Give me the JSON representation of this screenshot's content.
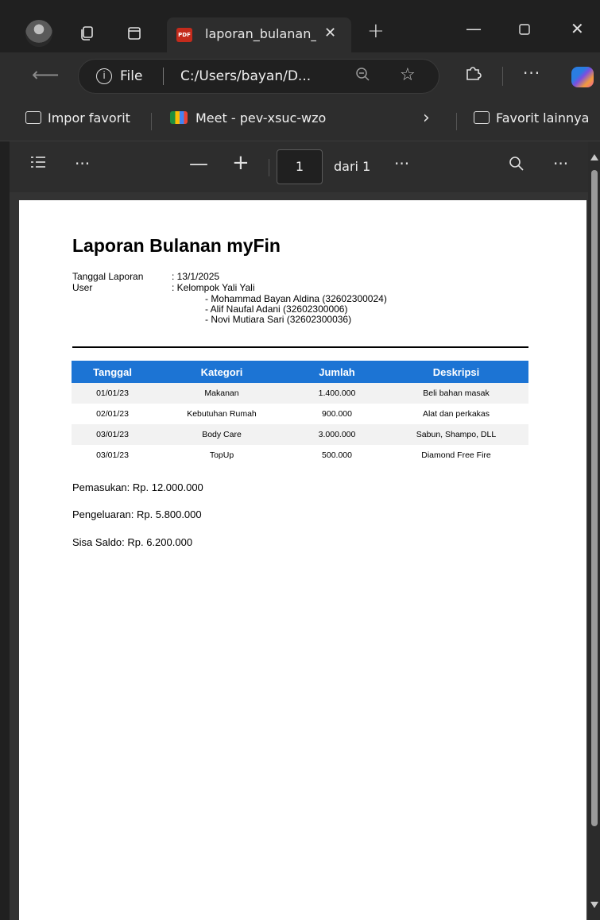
{
  "tab": {
    "title": "laporan_bulanan_",
    "pdf_badge": "PDF"
  },
  "address": {
    "scheme": "File",
    "url": "C:/Users/bayan/D..."
  },
  "favorites": {
    "import": "Impor favorit",
    "meet": "Meet - pev-xsuc-wzo",
    "others": "Favorit lainnya"
  },
  "pdf_toolbar": {
    "page": "1",
    "of": "dari 1"
  },
  "report": {
    "title": "Laporan Bulanan myFin",
    "date_label": "Tanggal Laporan",
    "date_value": ":  13/1/2025",
    "user_label": "User",
    "user_value": ":  Kelompok Yali Yali",
    "members": [
      "- Mohammad Bayan Aldina (32602300024)",
      "- Alif Naufal Adani (32602300006)",
      "- Novi Mutiara Sari (32602300036)"
    ],
    "columns": [
      "Tanggal",
      "Kategori",
      "Jumlah",
      "Deskripsi"
    ],
    "rows": [
      [
        "01/01/23",
        "Makanan",
        "1.400.000",
        "Beli bahan masak"
      ],
      [
        "02/01/23",
        "Kebutuhan Rumah",
        "900.000",
        "Alat dan perkakas"
      ],
      [
        "03/01/23",
        "Body Care",
        "3.000.000",
        "Sabun, Shampo, DLL"
      ],
      [
        "03/01/23",
        "TopUp",
        "500.000",
        "Diamond Free Fire"
      ]
    ],
    "income": "Pemasukan: Rp. 12.000.000",
    "expense": "Pengeluaran: Rp. 5.800.000",
    "balance": "Sisa Saldo: Rp. 6.200.000"
  },
  "colors": {
    "table_header": "#1c74d4",
    "pdf_badge": "#c42b1c"
  }
}
